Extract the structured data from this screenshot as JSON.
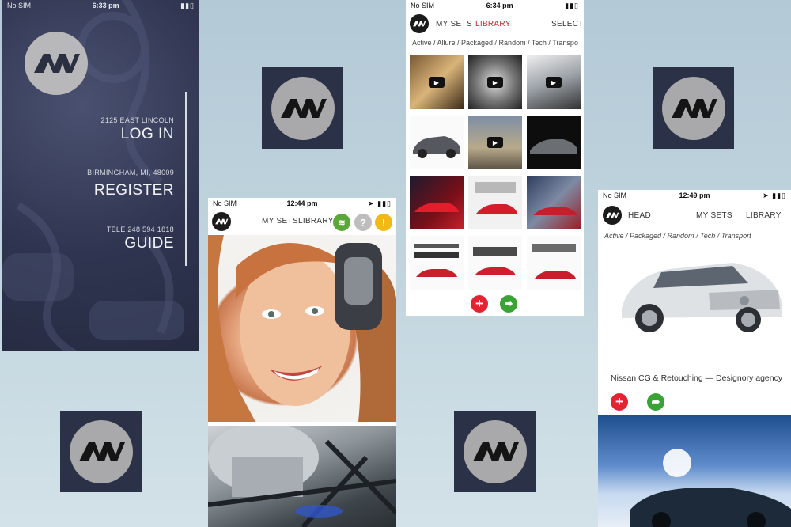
{
  "tiles": [
    "aw-logo",
    "aw-logo",
    "aw-logo",
    "aw-logo",
    "aw-logo"
  ],
  "screen1": {
    "status": {
      "carrier": "No SIM",
      "time": "6:33 pm"
    },
    "address1": "2125 EAST LINCOLN",
    "login": "LOG IN",
    "address2": "BIRMINGHAM, MI, 48009",
    "register": "REGISTER",
    "phone": "TELE 248 594 1818",
    "guide": "GUIDE"
  },
  "screen2": {
    "status": {
      "carrier": "No SIM",
      "time": "12:44 pm"
    },
    "nav": {
      "my_sets": "MY SETS",
      "library": "LIBRARY"
    },
    "icons": [
      "wifi-icon",
      "help-icon",
      "alert-icon"
    ]
  },
  "screen3": {
    "status": {
      "carrier": "No SIM",
      "time": "6:34 pm"
    },
    "nav": {
      "my_sets": "MY SETS",
      "library": "LIBRARY",
      "select": "SELECT"
    },
    "filters": "Active / Allure / Packaged / Random / Tech / Transpo",
    "thumbnails": [
      "video",
      "video",
      "video",
      "car",
      "video",
      "car",
      "car",
      "car",
      "car",
      "text",
      "text",
      "text"
    ]
  },
  "screen4": {
    "status": {
      "carrier": "No SIM",
      "time": "12:49 pm"
    },
    "nav": {
      "head": "HEAD",
      "my_sets": "MY SETS",
      "library": "LIBRARY"
    },
    "filters": "Active / Packaged / Random / Tech / Transport",
    "caption": "Nissan CG & Retouching — Designory agency"
  },
  "colors": {
    "accent_red": "#e52230",
    "accent_green": "#3aa335",
    "library_active": "#d0212e"
  }
}
